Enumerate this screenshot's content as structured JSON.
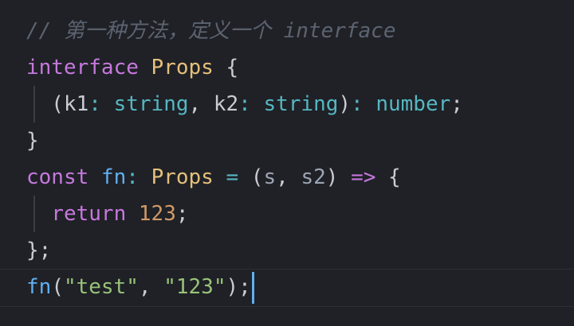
{
  "editor": {
    "lines": [
      {
        "tokens": [
          {
            "text": "// 第一种方法，定义一个 interface",
            "kind": "comment"
          }
        ]
      },
      {
        "tokens": [
          {
            "text": "interface",
            "kind": "keyword"
          },
          {
            "text": " ",
            "kind": "space"
          },
          {
            "text": "Props",
            "kind": "type"
          },
          {
            "text": " {",
            "kind": "punctuation"
          }
        ]
      },
      {
        "tokens": [
          {
            "text": "  (",
            "kind": "punctuation"
          },
          {
            "text": "k1",
            "kind": "text"
          },
          {
            "text": ":",
            "kind": "operator"
          },
          {
            "text": " ",
            "kind": "space"
          },
          {
            "text": "string",
            "kind": "primitive"
          },
          {
            "text": ", ",
            "kind": "punctuation"
          },
          {
            "text": "k2",
            "kind": "text"
          },
          {
            "text": ":",
            "kind": "operator"
          },
          {
            "text": " ",
            "kind": "space"
          },
          {
            "text": "string",
            "kind": "primitive"
          },
          {
            "text": ")",
            "kind": "punctuation"
          },
          {
            "text": ":",
            "kind": "operator"
          },
          {
            "text": " ",
            "kind": "space"
          },
          {
            "text": "number",
            "kind": "primitive"
          },
          {
            "text": ";",
            "kind": "punctuation"
          }
        ]
      },
      {
        "tokens": [
          {
            "text": "}",
            "kind": "punctuation"
          }
        ]
      },
      {
        "tokens": [
          {
            "text": "const",
            "kind": "keyword"
          },
          {
            "text": " ",
            "kind": "space"
          },
          {
            "text": "fn",
            "kind": "function"
          },
          {
            "text": ":",
            "kind": "operator"
          },
          {
            "text": " ",
            "kind": "space"
          },
          {
            "text": "Props",
            "kind": "type"
          },
          {
            "text": " ",
            "kind": "space"
          },
          {
            "text": "=",
            "kind": "operator"
          },
          {
            "text": " (",
            "kind": "punctuation"
          },
          {
            "text": "s",
            "kind": "param"
          },
          {
            "text": ", ",
            "kind": "punctuation"
          },
          {
            "text": "s2",
            "kind": "param"
          },
          {
            "text": ") ",
            "kind": "punctuation"
          },
          {
            "text": "=>",
            "kind": "keyword"
          },
          {
            "text": " {",
            "kind": "punctuation"
          }
        ]
      },
      {
        "tokens": [
          {
            "text": "  ",
            "kind": "space"
          },
          {
            "text": "return",
            "kind": "keyword"
          },
          {
            "text": " ",
            "kind": "space"
          },
          {
            "text": "123",
            "kind": "number"
          },
          {
            "text": ";",
            "kind": "punctuation"
          }
        ]
      },
      {
        "tokens": [
          {
            "text": "};",
            "kind": "punctuation"
          }
        ]
      },
      {
        "tokens": [
          {
            "text": "fn",
            "kind": "function"
          },
          {
            "text": "(",
            "kind": "punctuation"
          },
          {
            "text": "\"test\"",
            "kind": "string"
          },
          {
            "text": ", ",
            "kind": "punctuation"
          },
          {
            "text": "\"123\"",
            "kind": "string"
          },
          {
            "text": ");",
            "kind": "punctuation"
          }
        ]
      }
    ],
    "cursor_line": 8
  },
  "colors": {
    "background": "#1f2126",
    "comment": "#5c6370",
    "keyword": "#c678dd",
    "type": "#e5c07b",
    "function": "#61afef",
    "primitive": "#56b6c2",
    "string": "#98c379",
    "number": "#d19a66",
    "cursor": "#61afef"
  }
}
